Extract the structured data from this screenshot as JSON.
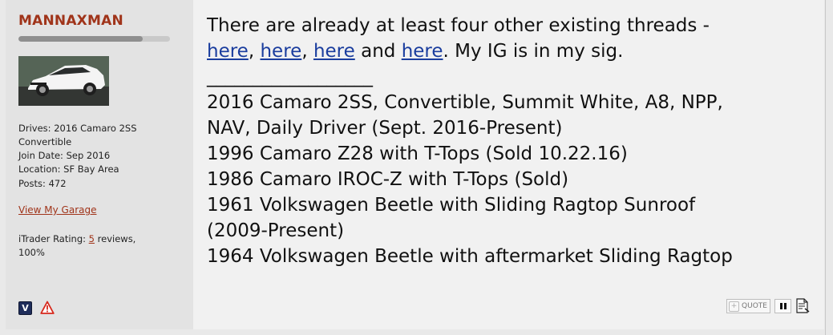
{
  "user": {
    "username": "MANNAXMAN",
    "reputation_fraction": 0.82,
    "drives_label": "Drives:",
    "drives_value": "2016 Camaro 2SS",
    "drives_value_2": "Convertible",
    "join_label": "Join Date:",
    "join_value": "Sep 2016",
    "location_label": "Location:",
    "location_value": "SF Bay Area",
    "posts_label": "Posts:",
    "posts_value": "472",
    "garage_link": "View My Garage",
    "itrader_label": "iTrader Rating:",
    "itrader_count": "5",
    "itrader_reviews": "reviews,",
    "itrader_percent": "100%",
    "verified_badge": "V"
  },
  "post": {
    "line1": "There are already at least four other existing threads -",
    "link_text": "here",
    "sep_comma": ",",
    "word_and": "and",
    "after_links": ". My IG is in my sig.",
    "signature_divider": "__________________",
    "signature": [
      "2016 Camaro 2SS, Convertible, Summit White, A8, NPP,",
      "NAV, Daily Driver (Sept. 2016-Present)",
      "1996 Camaro Z28 with T-Tops (Sold 10.22.16)",
      "1986 Camaro IROC-Z with T-Tops (Sold)",
      "1961 Volkswagen Beetle with Sliding Ragtop Sunroof",
      "(2009-Present)",
      "1964 Volkswagen Beetle with aftermarket Sliding Ragtop"
    ]
  },
  "actions": {
    "quote_label": "QUOTE",
    "icons": [
      "multi-quote-icon",
      "pause-icon",
      "report-icon"
    ]
  },
  "colors": {
    "username": "#a0341a",
    "link": "#1a3d9e",
    "sidebar_bg": "#e3e3e3",
    "content_bg": "#f1f1f1"
  }
}
